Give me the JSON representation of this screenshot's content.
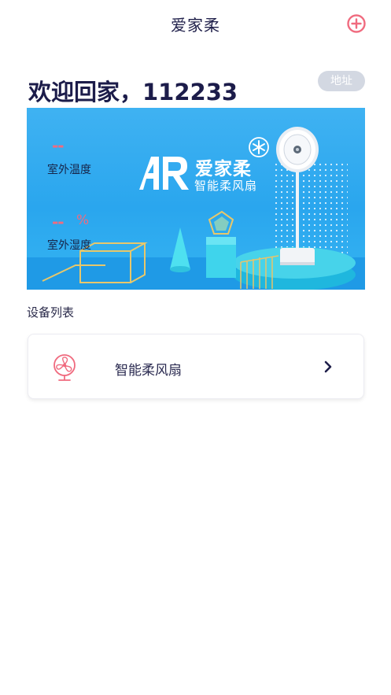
{
  "header": {
    "title": "爱家柔"
  },
  "welcome": {
    "text": "欢迎回家，112233",
    "address_button": "地址"
  },
  "banner": {
    "temperature_value": "--",
    "temperature_label": "室外温度",
    "humidity_value": "--",
    "humidity_unit": "%",
    "humidity_label": "室外湿度",
    "brand_name": "爱家柔",
    "brand_sub": "智能柔风扇"
  },
  "devices": {
    "section_title": "设备列表",
    "items": [
      {
        "name": "智能柔风扇",
        "icon": "fan-icon"
      }
    ]
  },
  "colors": {
    "accent": "#f06b7f",
    "primary_text": "#1c1c4a",
    "banner_bg": "#2aa6ee"
  }
}
